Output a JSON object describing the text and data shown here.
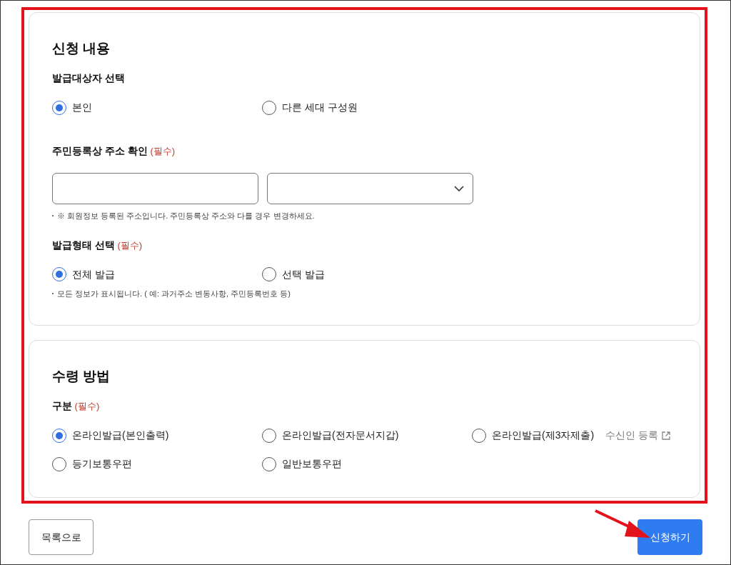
{
  "sections": [
    {
      "title": "신청 내용",
      "groups": [
        {
          "kind": "radio",
          "label": "발급대상자 선택",
          "options": [
            {
              "label": "본인",
              "selected": true
            },
            {
              "label": "다른 세대 구성원",
              "selected": false
            }
          ]
        },
        {
          "kind": "address",
          "label": "주민등록상 주소 확인",
          "required": "(필수)",
          "note": "※ 회원정보 등록된 주소입니다. 주민등록상 주소와 다를 경우 변경하세요."
        },
        {
          "kind": "radio",
          "label": "발급형태 선택",
          "required": "(필수)",
          "options": [
            {
              "label": "전체 발급",
              "selected": true
            },
            {
              "label": "선택 발급",
              "selected": false
            }
          ],
          "note": "모든 정보가 표시됩니다. ( 예: 과거주소 변동사항, 주민등록번호 등)"
        }
      ]
    },
    {
      "title": "수령 방법",
      "groups": [
        {
          "kind": "radio",
          "label": "구분",
          "required": "(필수)",
          "options": [
            {
              "label": "온라인발급(본인출력)",
              "selected": true
            },
            {
              "label": "온라인발급(전자문서지갑)",
              "selected": false
            },
            {
              "label": "온라인발급(제3자제출)",
              "selected": false,
              "link": "수신인 등록"
            },
            {
              "label": "등기보통우편",
              "selected": false
            },
            {
              "label": "일반보통우편",
              "selected": false
            }
          ]
        }
      ]
    }
  ],
  "actions": [
    {
      "kind": "secondary",
      "label": "목록으로"
    },
    {
      "kind": "primary",
      "label": "신청하기"
    }
  ]
}
